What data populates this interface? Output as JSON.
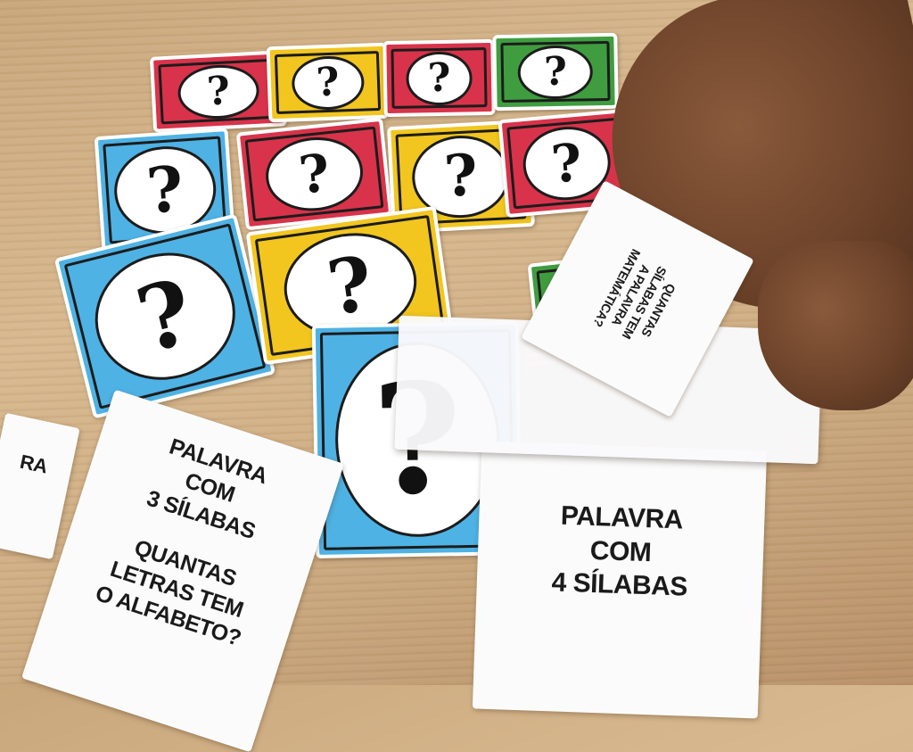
{
  "scene": {
    "description_label": "Cartas de jogo educativo sobre mesa de madeira",
    "question_mark": "?",
    "card_colors": {
      "red": "#d8334a",
      "yellow": "#f2c61f",
      "green": "#3f9d3f",
      "blue": "#4eb2e4"
    }
  },
  "cards": {
    "left_partial": "RA",
    "card_3_silabas": {
      "line1": "PALAVRA",
      "line2": "COM",
      "line3": "3 SÍLABAS",
      "line4": "QUANTAS",
      "line5": "LETRAS TEM",
      "line6": "O ALFABETO?"
    },
    "card_4_silabas": {
      "line1": "PALAVRA",
      "line2": "COM",
      "line3": "4 SÍLABAS"
    },
    "peeled_card": {
      "line1": "QUANTAS",
      "line2": "SÍLABAS TEM",
      "line3": "A PALAVRA",
      "line4": "MATEMÁTICA?"
    }
  }
}
